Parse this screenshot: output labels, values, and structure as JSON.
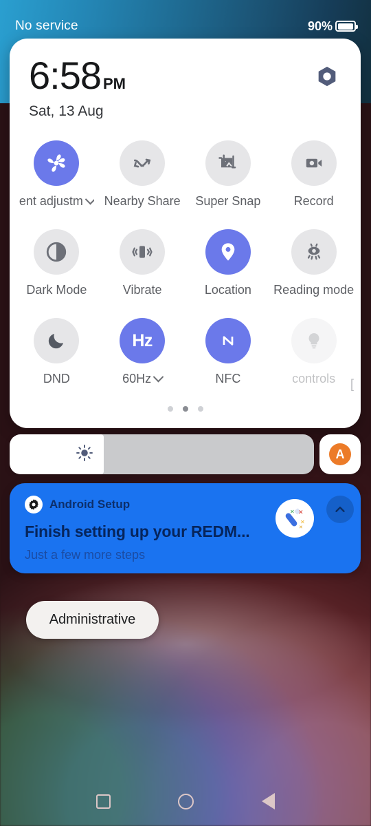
{
  "status_bar": {
    "carrier": "No service",
    "battery_percent": "90%",
    "battery_icon": "battery-icon"
  },
  "quick_settings": {
    "clock": {
      "time": "6:58",
      "ampm": "PM",
      "date": "Sat, 13 Aug"
    },
    "settings_icon": "gear-icon",
    "tiles": [
      {
        "label": "ent adjustm",
        "icon": "fan-icon",
        "active": true,
        "has_chevron": true,
        "truncated": true
      },
      {
        "label": "Nearby Share",
        "icon": "nearby-share-icon",
        "active": false,
        "has_chevron": false,
        "truncated": false
      },
      {
        "label": "Super Snap",
        "icon": "screenshot-icon",
        "active": false,
        "has_chevron": false,
        "truncated": false
      },
      {
        "label": "Record",
        "icon": "video-camera-icon",
        "active": false,
        "has_chevron": false,
        "truncated": false
      },
      {
        "label": "Dark Mode",
        "icon": "contrast-icon",
        "active": false,
        "has_chevron": false,
        "truncated": false
      },
      {
        "label": "Vibrate",
        "icon": "vibrate-icon",
        "active": false,
        "has_chevron": false,
        "truncated": false
      },
      {
        "label": "Location",
        "icon": "location-pin-icon",
        "active": true,
        "has_chevron": false,
        "truncated": false
      },
      {
        "label": "Reading mode",
        "icon": "eye-icon",
        "active": false,
        "has_chevron": false,
        "truncated": false
      },
      {
        "label": "DND",
        "icon": "moon-icon",
        "active": false,
        "has_chevron": false,
        "truncated": false
      },
      {
        "label": "60Hz",
        "icon": "hz-icon",
        "active": true,
        "has_chevron": true,
        "truncated": false
      },
      {
        "label": "NFC",
        "icon": "nfc-icon",
        "active": true,
        "has_chevron": false,
        "truncated": false
      },
      {
        "label": "controls",
        "icon": "lightbulb-icon",
        "active": false,
        "has_chevron": false,
        "truncated": true
      }
    ],
    "edge_ghost_label": "[",
    "pages": {
      "count": 3,
      "active_index": 1
    }
  },
  "brightness": {
    "slider_icon": "brightness-sun-icon",
    "fill_percent": "31%",
    "auto_label": "A"
  },
  "notification": {
    "app_name": "Android Setup",
    "app_icon": "gear-icon",
    "title": "Finish setting up your REDM...",
    "subtitle": "Just a few more steps",
    "art_icon": "magic-wand-icon",
    "collapse_icon": "chevron-up-icon"
  },
  "floating_pill": {
    "label": "Administrative"
  },
  "nav_bar": {
    "recents_icon": "square-icon",
    "home_icon": "circle-icon",
    "back_icon": "triangle-back-icon"
  },
  "colors": {
    "accent_tile": "#6b79ea",
    "notification_blue": "#1a73f0",
    "auto_brightness": "#ec7b28",
    "tile_off": "#e6e6e8"
  }
}
